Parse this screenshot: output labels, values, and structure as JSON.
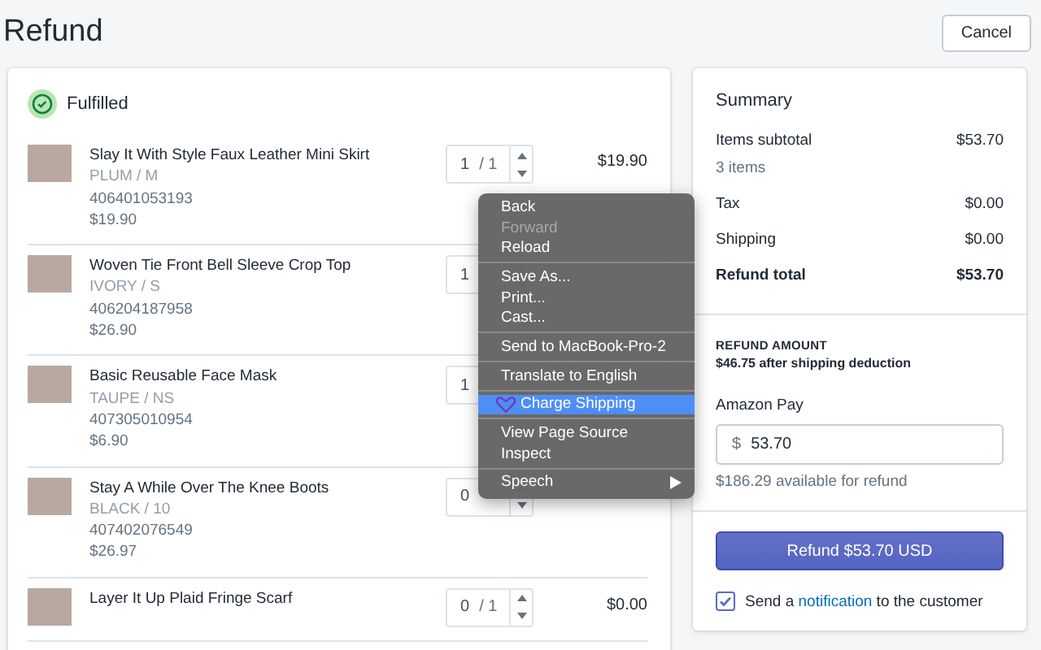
{
  "header": {
    "title": "Refund",
    "cancel_button": "Cancel"
  },
  "fulfillment": {
    "status": "Fulfilled",
    "items": [
      {
        "name": "Slay It With Style Faux Leather Mini Skirt",
        "variant": "PLUM / M",
        "sku": "406401053193",
        "unit_price": "$19.90",
        "quantity": "1",
        "of": "/ 1",
        "total": "$19.90"
      },
      {
        "name": "Woven Tie Front Bell Sleeve Crop Top",
        "variant": "IVORY / S",
        "sku": "406204187958",
        "unit_price": "$26.90",
        "quantity": "1"
      },
      {
        "name": "Basic Reusable Face Mask",
        "variant": "TAUPE / NS",
        "sku": "407305010954",
        "unit_price": "$6.90",
        "quantity": "1"
      },
      {
        "name": "Stay A While Over The Knee Boots",
        "variant": "BLACK / 10",
        "sku": "407402076549",
        "unit_price": "$26.97",
        "quantity": "0"
      },
      {
        "name": "Layer It Up Plaid Fringe Scarf",
        "quantity": "0",
        "of": "/ 1",
        "total": "$0.00"
      }
    ]
  },
  "summary": {
    "title": "Summary",
    "rows": [
      {
        "label": "Items subtotal",
        "value": "$53.70",
        "note": "3 items",
        "bold": false
      },
      {
        "label": "Tax",
        "value": "$0.00",
        "bold": false
      },
      {
        "label": "Shipping",
        "value": "$0.00",
        "bold": false
      },
      {
        "label": "Refund total",
        "value": "$53.70",
        "bold": true
      }
    ],
    "refund_amount_label": "REFUND AMOUNT",
    "refund_amount_note": "$46.75 after shipping deduction",
    "method_label": "Amazon Pay",
    "currency": "$",
    "amount": "53.70",
    "available": "$186.29 available for refund",
    "refund_button": "Refund $53.70 USD",
    "notify": {
      "checked": true,
      "before": "Send a",
      "link": "notification",
      "after": "to the customer"
    }
  },
  "context_menu": {
    "groups": [
      [
        {
          "label": "Back",
          "disabled": false,
          "selected": false,
          "submenu": false
        },
        {
          "label": "Forward",
          "disabled": true,
          "selected": false,
          "submenu": false
        },
        {
          "label": "Reload",
          "disabled": false,
          "selected": false,
          "submenu": false
        }
      ],
      [
        {
          "label": "Save As...",
          "disabled": false,
          "selected": false,
          "submenu": false
        },
        {
          "label": "Print...",
          "disabled": false,
          "selected": false,
          "submenu": false
        },
        {
          "label": "Cast...",
          "disabled": false,
          "selected": false,
          "submenu": false
        }
      ],
      [
        {
          "label": "Send to MacBook-Pro-2",
          "disabled": false,
          "selected": false,
          "submenu": false
        }
      ],
      [
        {
          "label": "Translate to English",
          "disabled": false,
          "selected": false,
          "submenu": false
        }
      ],
      [
        {
          "label": "Charge Shipping",
          "disabled": false,
          "selected": true,
          "submenu": false,
          "icon": true
        }
      ],
      [
        {
          "label": "View Page Source",
          "disabled": false,
          "selected": false,
          "submenu": false
        },
        {
          "label": "Inspect",
          "disabled": false,
          "selected": false,
          "submenu": false
        }
      ],
      [
        {
          "label": "Speech",
          "disabled": false,
          "selected": false,
          "submenu": true
        }
      ]
    ]
  }
}
